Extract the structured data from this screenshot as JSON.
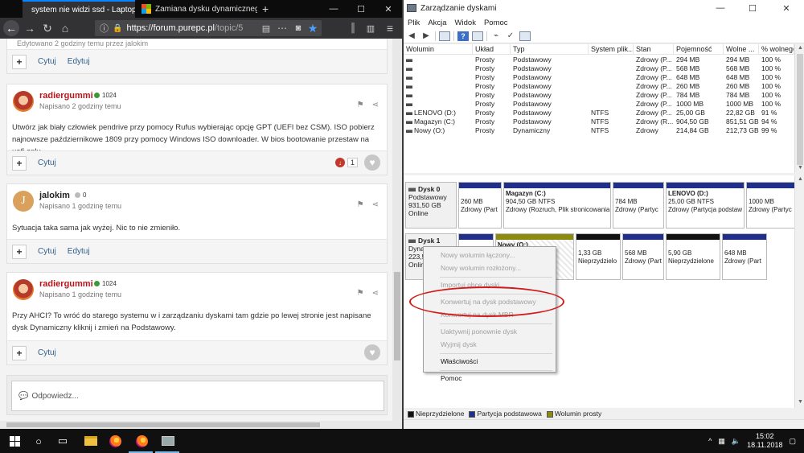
{
  "browser": {
    "tabs": [
      {
        "title": "system nie widzi ssd - Laptopy",
        "active": true
      },
      {
        "title": "Zamiana dysku dynamicznego",
        "active": false
      }
    ],
    "url_host": "https://forum.purepc.pl",
    "url_rest": "/topic/5",
    "edited_note": "Edytowano 2 godziny temu przez jalokim",
    "posts": [
      {
        "author": "radiergummi",
        "reputation": "1024",
        "posted": "Napisano 2 godziny temu",
        "body": "Utwórz jak biały człowiek pendrive przy pomocy Rufus wybierając opcję GPT (UEFI bez CSM). ISO pobierz najnowsze październikowe 1809 przy pomocy Windows ISO downloader. W bios bootowanie przestaw na uefi only.",
        "actions": [
          "Cytuj"
        ],
        "downvotes": "1"
      },
      {
        "author": "jalokim",
        "avatar_letter": "J",
        "reputation": "0",
        "posted": "Napisano 1 godzinę temu",
        "body": "Sytuacja taka sama jak wyżej. Nic to nie zmieniło.",
        "actions": [
          "Cytuj",
          "Edytuj"
        ]
      },
      {
        "author": "radiergummi",
        "reputation": "1024",
        "posted": "Napisano 1 godzinę temu",
        "body": "Przy AHCI? To wróć do starego systemu w i zarządzaniu dyskami tam gdzie po lewej stronie jest napisane dysk Dynamiczny kliknij i zmień na Podstawowy.",
        "actions": [
          "Cytuj"
        ]
      }
    ],
    "top_actions": [
      "Cytuj",
      "Edytuj"
    ],
    "reply_placeholder": "Odpowiedz..."
  },
  "disk_mgmt": {
    "title": "Zarządzanie dyskami",
    "menu": [
      "Plik",
      "Akcja",
      "Widok",
      "Pomoc"
    ],
    "columns": [
      "Wolumin",
      "Układ",
      "Typ",
      "System plik...",
      "Stan",
      "Pojemność",
      "Wolne ...",
      "% wolnego"
    ],
    "volumes": [
      {
        "name": "",
        "layout": "Prosty",
        "type": "Podstawowy",
        "fs": "",
        "status": "Zdrowy (P...",
        "capacity": "294 MB",
        "free": "294 MB",
        "pct": "100 %"
      },
      {
        "name": "",
        "layout": "Prosty",
        "type": "Podstawowy",
        "fs": "",
        "status": "Zdrowy (P...",
        "capacity": "568 MB",
        "free": "568 MB",
        "pct": "100 %"
      },
      {
        "name": "",
        "layout": "Prosty",
        "type": "Podstawowy",
        "fs": "",
        "status": "Zdrowy (P...",
        "capacity": "648 MB",
        "free": "648 MB",
        "pct": "100 %"
      },
      {
        "name": "",
        "layout": "Prosty",
        "type": "Podstawowy",
        "fs": "",
        "status": "Zdrowy (P...",
        "capacity": "260 MB",
        "free": "260 MB",
        "pct": "100 %"
      },
      {
        "name": "",
        "layout": "Prosty",
        "type": "Podstawowy",
        "fs": "",
        "status": "Zdrowy (P...",
        "capacity": "784 MB",
        "free": "784 MB",
        "pct": "100 %"
      },
      {
        "name": "",
        "layout": "Prosty",
        "type": "Podstawowy",
        "fs": "",
        "status": "Zdrowy (P...",
        "capacity": "1000 MB",
        "free": "1000 MB",
        "pct": "100 %"
      },
      {
        "name": "LENOVO (D:)",
        "layout": "Prosty",
        "type": "Podstawowy",
        "fs": "NTFS",
        "status": "Zdrowy (P...",
        "capacity": "25,00 GB",
        "free": "22,82 GB",
        "pct": "91 %"
      },
      {
        "name": "Magazyn (C:)",
        "layout": "Prosty",
        "type": "Podstawowy",
        "fs": "NTFS",
        "status": "Zdrowy (R...",
        "capacity": "904,50 GB",
        "free": "851,51 GB",
        "pct": "94 %"
      },
      {
        "name": "Nowy (O:)",
        "layout": "Prosty",
        "type": "Dynamiczny",
        "fs": "NTFS",
        "status": "Zdrowy",
        "capacity": "214,84 GB",
        "free": "212,73 GB",
        "pct": "99 %"
      }
    ],
    "disk0": {
      "name": "Dysk 0",
      "type": "Podstawowy",
      "size": "931,50 GB",
      "state": "Online",
      "partitions": [
        {
          "title": "",
          "line1": "260 MB",
          "line2": "Zdrowy (Part"
        },
        {
          "title": "Magazyn (C:)",
          "line1": "904,50 GB NTFS",
          "line2": "Zdrowy (Rozruch, Plik stronicowania"
        },
        {
          "title": "",
          "line1": "784 MB",
          "line2": "Zdrowy (Partyc"
        },
        {
          "title": "LENOVO (D:)",
          "line1": "25,00 GB NTFS",
          "line2": "Zdrowy (Partycja podstaw"
        },
        {
          "title": "",
          "line1": "1000 MB",
          "line2": "Zdrowy (Partyc"
        }
      ]
    },
    "disk1": {
      "name": "Dysk 1",
      "type": "Dynamiczny",
      "size": "223,5",
      "state": "Onlin",
      "partitions": [
        {
          "line1": "",
          "line2": ""
        },
        {
          "line1": "Nowy (O:)",
          "line2": ""
        },
        {
          "line1": "1,33 GB",
          "line2": "Nieprzydzielo"
        },
        {
          "line1": "568 MB",
          "line2": "Zdrowy (Part"
        },
        {
          "line1": "5,90 GB",
          "line2": "Nieprzydzielone"
        },
        {
          "line1": "648 MB",
          "line2": "Zdrowy (Part"
        }
      ]
    },
    "context_menu": [
      {
        "label": "Nowy wolumin łączony...",
        "enabled": false
      },
      {
        "label": "Nowy wolumin rozłożony...",
        "enabled": false
      },
      {
        "sep": true
      },
      {
        "label": "Importuj obce dyski...",
        "enabled": false
      },
      {
        "sep": true
      },
      {
        "label": "Konwertuj na dysk podstawowy",
        "enabled": false
      },
      {
        "label": "Konwertuj na dysk MBR",
        "enabled": false
      },
      {
        "sep": true
      },
      {
        "label": "Uaktywnij ponownie dysk",
        "enabled": false
      },
      {
        "label": "Wyjmij dysk",
        "enabled": false
      },
      {
        "sep": true
      },
      {
        "label": "Właściwości",
        "enabled": true
      },
      {
        "sep": true
      },
      {
        "label": "Pomoc",
        "enabled": true
      }
    ],
    "legend": [
      {
        "label": "Nieprzydzielone",
        "color": "#111111"
      },
      {
        "label": "Partycja podstawowa",
        "color": "#1f2f8a"
      },
      {
        "label": "Wolumin prosty",
        "color": "#8b8b10"
      }
    ]
  },
  "taskbar": {
    "time": "15:02",
    "date": "18.11.2018"
  }
}
